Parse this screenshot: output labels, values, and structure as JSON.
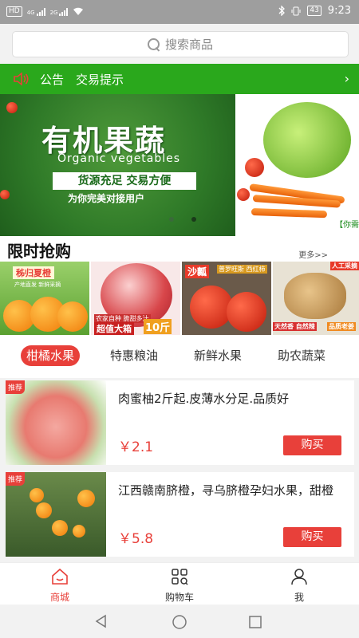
{
  "status_bar": {
    "left_badge": "HD",
    "signal1_label": "4G",
    "signal2_label": "2G",
    "battery": "43",
    "time": "9:23"
  },
  "search": {
    "placeholder": "搜索商品"
  },
  "notice": {
    "label1": "公告",
    "label2": "交易提示",
    "chevron": "›"
  },
  "banner": {
    "title_cn": "有机果蔬",
    "title_en": "Organic vegetables",
    "slogan": "货源充足  交易方便",
    "sub": "为你完美对接用户",
    "side_tag": "【你需"
  },
  "flash_sale": {
    "title": "限时抢购",
    "more": "更多>>",
    "items": [
      {
        "label": "秭归夏橙",
        "sub": "产地直发 新鲜采摘"
      },
      {
        "label": "超值大箱",
        "badge": "10斤",
        "sub": "农家自种 脆甜多汁"
      },
      {
        "label": "沙瓤",
        "sub": "普罗旺斯 西红柿"
      },
      {
        "label": "天然香 自然辣",
        "badge": "人工采摘",
        "sub": "品质老姜"
      }
    ]
  },
  "category_tabs": [
    "柑橘水果",
    "特惠粮油",
    "新鲜水果",
    "助农蔬菜"
  ],
  "products": [
    {
      "badge": "推荐",
      "title": "肉蜜柚2斤起.皮薄水分足.品质好",
      "price": "￥2.1",
      "buy": "购买"
    },
    {
      "badge": "推荐",
      "title": "江西赣南脐橙，寻乌脐橙孕妇水果，甜橙",
      "price": "￥5.8",
      "buy": "购买"
    }
  ],
  "tabbar": [
    {
      "label": "商城",
      "icon": "home-icon",
      "active": true
    },
    {
      "label": "购物车",
      "icon": "cart-grid-icon",
      "active": false
    },
    {
      "label": "我",
      "icon": "user-icon",
      "active": false
    }
  ],
  "colors": {
    "accent": "#e8403a",
    "notice_bg": "#2aa81c",
    "status_bg": "#9e9e9e"
  }
}
